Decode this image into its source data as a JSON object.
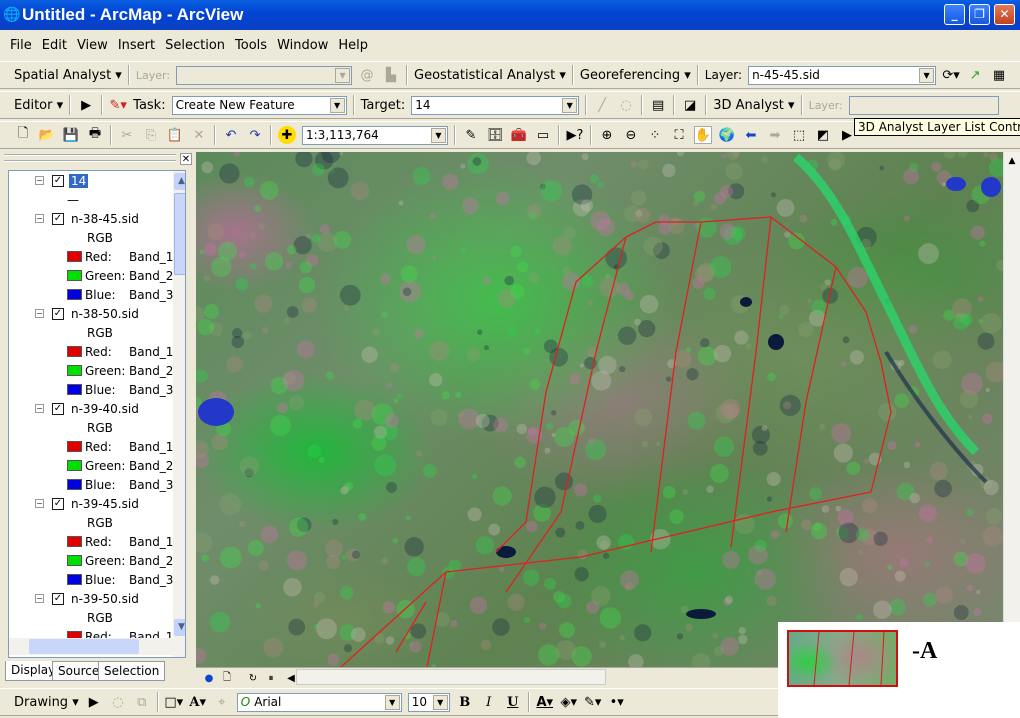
{
  "window": {
    "title": "Untitled - ArcMap - ArcView"
  },
  "menu": [
    "File",
    "Edit",
    "View",
    "Insert",
    "Selection",
    "Tools",
    "Window",
    "Help"
  ],
  "toolbar1": {
    "spatial_analyst": "Spatial Analyst",
    "layer_label": "Layer:",
    "layer_value": "",
    "geostatistical": "Geostatistical Analyst",
    "georeferencing": "Georeferencing",
    "geo_layer_label": "Layer:",
    "geo_layer_value": "n-45-45.sid"
  },
  "toolbar2": {
    "editor": "Editor",
    "task_label": "Task:",
    "task_value": "Create New Feature",
    "target_label": "Target:",
    "target_value": "14",
    "analyst3d": "3D Analyst",
    "layer_label": "Layer:"
  },
  "toolbar3": {
    "scale": "1:3,113,764"
  },
  "tooltip": "3D Analyst Layer List Control",
  "toc": {
    "items": [
      {
        "type": "layer",
        "label": "14",
        "selected": true
      },
      {
        "type": "line",
        "label": "—"
      },
      {
        "type": "layer",
        "label": "n-38-45.sid"
      },
      {
        "type": "rgb",
        "label": "RGB"
      },
      {
        "type": "band",
        "label": "Red:",
        "band": "Band_1",
        "color": "#e00000"
      },
      {
        "type": "band",
        "label": "Green:",
        "band": "Band_2",
        "color": "#00e000"
      },
      {
        "type": "band",
        "label": "Blue:",
        "band": "Band_3",
        "color": "#0000e0"
      },
      {
        "type": "layer",
        "label": "n-38-50.sid"
      },
      {
        "type": "rgb",
        "label": "RGB"
      },
      {
        "type": "band",
        "label": "Red:",
        "band": "Band_1",
        "color": "#e00000"
      },
      {
        "type": "band",
        "label": "Green:",
        "band": "Band_2",
        "color": "#00e000"
      },
      {
        "type": "band",
        "label": "Blue:",
        "band": "Band_3",
        "color": "#0000e0"
      },
      {
        "type": "layer",
        "label": "n-39-40.sid"
      },
      {
        "type": "rgb",
        "label": "RGB"
      },
      {
        "type": "band",
        "label": "Red:",
        "band": "Band_1",
        "color": "#e00000"
      },
      {
        "type": "band",
        "label": "Green:",
        "band": "Band_2",
        "color": "#00e000"
      },
      {
        "type": "band",
        "label": "Blue:",
        "band": "Band_3",
        "color": "#0000e0"
      },
      {
        "type": "layer",
        "label": "n-39-45.sid"
      },
      {
        "type": "rgb",
        "label": "RGB"
      },
      {
        "type": "band",
        "label": "Red:",
        "band": "Band_1",
        "color": "#e00000"
      },
      {
        "type": "band",
        "label": "Green:",
        "band": "Band_2",
        "color": "#00e000"
      },
      {
        "type": "band",
        "label": "Blue:",
        "band": "Band_3",
        "color": "#0000e0"
      },
      {
        "type": "layer",
        "label": "n-39-50.sid"
      },
      {
        "type": "rgb",
        "label": "RGB"
      },
      {
        "type": "band",
        "label": "Red:",
        "band": "Band_1",
        "color": "#e00000"
      }
    ],
    "tabs": [
      "Display",
      "Source",
      "Selection"
    ]
  },
  "drawing": {
    "label": "Drawing",
    "font": "Arial",
    "size": "10",
    "bold": "B",
    "italic": "I",
    "underline": "U"
  },
  "inset": {
    "label": "-A"
  },
  "colors": {
    "outline": "#e02020",
    "title": "#0146d6"
  }
}
